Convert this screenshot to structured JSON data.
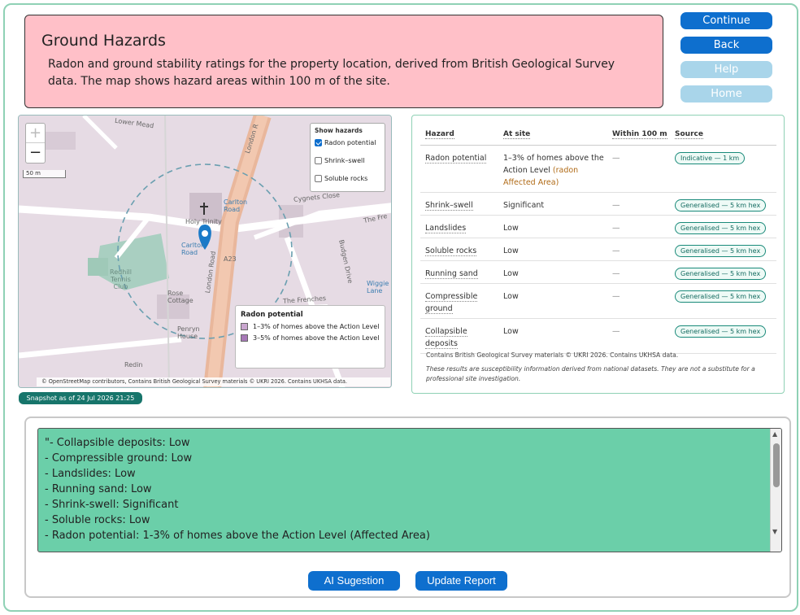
{
  "header": {
    "title": "Ground Hazards",
    "description": "Radon and ground stability ratings for the property location, derived from British Geological Survey data. The map shows hazard areas within 100 m of the site."
  },
  "nav": {
    "continue_label": "Continue",
    "back_label": "Back",
    "help_label": "Help",
    "home_label": "Home"
  },
  "map": {
    "zoom_in": "+",
    "zoom_out": "−",
    "scale": "50 m",
    "labels": {
      "lower_mead": "Lower Mead",
      "london_r": "London R",
      "london_road": "London Road",
      "holy_trinity": "Holy Trinity",
      "carlton_road_1": "Carlton\nRoad",
      "carlton_road_2": "Carlton\nRoad",
      "cygnets_close": "Cygnets Close",
      "the_fre": "The Fre",
      "a23": "A23",
      "budgen_drive": "Budgen Drive",
      "redhill_tennis_club": "Redhill\nTennis\nClub",
      "rose_cottage": "Rose\nCottage",
      "the_frenches": "The Frenches",
      "wiggie_lane": "Wiggie\nLane",
      "penryn_house": "Penryn\nHouse",
      "redin": "Redin"
    },
    "layers": {
      "title": "Show hazards",
      "items": [
        {
          "label": "Radon potential",
          "checked": true
        },
        {
          "label": "Shrink–swell",
          "checked": false
        },
        {
          "label": "Soluble rocks",
          "checked": false
        }
      ]
    },
    "legend": {
      "title": "Radon potential",
      "items": [
        {
          "label": "1–3% of homes above the Action Level",
          "color": "#c9a6cf"
        },
        {
          "label": "3–5% of homes above the Action Level",
          "color": "#a779b7"
        }
      ]
    },
    "attribution": "© OpenStreetMap contributors, Contains British Geological Survey materials © UKRI 2026. Contains UKHSA data."
  },
  "snapshot": "Snapshot as of 24 Jul 2026 21:25",
  "hazard_table": {
    "headers": [
      "Hazard",
      "At site",
      "Within 100 m",
      "Source"
    ],
    "rows": [
      {
        "hazard": "Radon potential",
        "at_site": "1–3% of homes above the Action Level",
        "note": "(radon Affected Area)",
        "within": "—",
        "source": "Indicative — 1 km"
      },
      {
        "hazard": "Shrink–swell",
        "at_site": "Significant",
        "note": "",
        "within": "—",
        "source": "Generalised — 5 km hex"
      },
      {
        "hazard": "Landslides",
        "at_site": "Low",
        "note": "",
        "within": "—",
        "source": "Generalised — 5 km hex"
      },
      {
        "hazard": "Soluble rocks",
        "at_site": "Low",
        "note": "",
        "within": "—",
        "source": "Generalised — 5 km hex"
      },
      {
        "hazard": "Running sand",
        "at_site": "Low",
        "note": "",
        "within": "—",
        "source": "Generalised — 5 km hex"
      },
      {
        "hazard": "Compressible ground",
        "at_site": "Low",
        "note": "",
        "within": "—",
        "source": "Generalised — 5 km hex"
      },
      {
        "hazard": "Collapsible deposits",
        "at_site": "Low",
        "note": "",
        "within": "—",
        "source": "Generalised — 5 km hex"
      }
    ],
    "credit": "Contains British Geological Survey materials © UKRI 2026. Contains UKHSA data.",
    "disclaimer": "These results are susceptibility information derived from national datasets. They are not a substitute for a professional site investigation."
  },
  "report": {
    "lines": [
      "\"- Collapsible deposits: Low",
      "- Compressible ground: Low",
      "- Landslides: Low",
      "- Running sand: Low",
      "- Shrink-swell: Significant",
      "- Soluble rocks: Low",
      "- Radon potential: 1-3% of homes above the Action Level (Affected Area)"
    ],
    "ai_button": "AI Sugestion",
    "update_button": "Update Report"
  },
  "colors": {
    "header_bg": "#ffc0c8",
    "primary_button": "#0e6fce",
    "muted_button": "#a9d5ea",
    "report_bg": "#6bcfa9",
    "snapshot_bg": "#17756b",
    "frame_border": "#8fd1b5"
  }
}
